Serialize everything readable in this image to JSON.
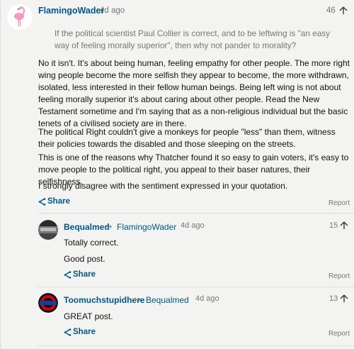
{
  "main_comment": {
    "username": "FlamingoWader",
    "time": "4d ago",
    "votes": "46",
    "quote": "If the political scientist Paul Collier is correct, and to be leftwing is \"an easy way of feeling morally superior\", then why not pander to morality?",
    "paragraphs": [
      "No it isn't. It's about being human, feeling empathy for other people. The more right wing people become the more selfish they appear to become, the more withdrawn, isolated, less interested in their fellow human beings. Being left wing is not about feeling morally superior it's about caring about other people. Read the New Testament sometime and I'm saying that as a non-religious individual but the basic tenets of a civilised society are in there.",
      "The political Right couldn't give a monkeys for people \"less\" than them, witness their policies towards the disabled and those sleeping on the streets.",
      "This is one of the reasons why Thatcher found it so easy to gain voters, it's easy to move people to the political right, you appeal to their baser natures, their selfishness.",
      "I strongly disagree with the sentiment expressed in your quotation."
    ],
    "share_label": "Share",
    "report_label": "Report"
  },
  "replies": [
    {
      "username": "Bequalmed",
      "reply_to": "FlamingoWader",
      "time": "4d ago",
      "votes": "15",
      "lines": [
        "Totally correct.",
        "Good post."
      ],
      "share_label": "Share",
      "report_label": "Report"
    },
    {
      "username": "Toomuchstupidhere",
      "reply_to": "Bequalmed",
      "time": "4d ago",
      "votes": "13",
      "lines": [
        "GREAT post."
      ],
      "share_label": "Share",
      "report_label": "Report",
      "avatar_text": "UNDERGROUND"
    }
  ],
  "colors": {
    "link": "#005689",
    "muted": "#767676",
    "background": "#f3f4f2"
  }
}
